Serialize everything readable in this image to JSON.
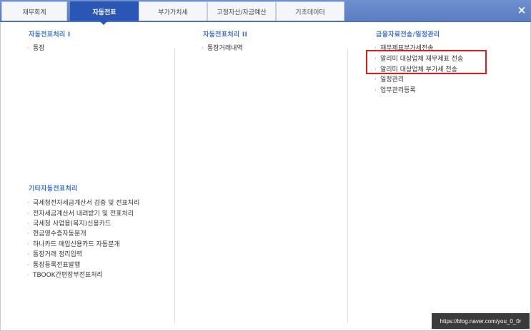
{
  "tabs": [
    {
      "label": "재무회계"
    },
    {
      "label": "자동전표"
    },
    {
      "label": "부가가치세"
    },
    {
      "label": "고정자산/자금예산"
    },
    {
      "label": "기초데이터"
    }
  ],
  "close_label": "×",
  "sections": {
    "auto1": {
      "heading": "자동전표처리 I",
      "items": [
        "통장"
      ]
    },
    "auto2": {
      "heading": "자동전표처리 II",
      "items": [
        "통장거래내역"
      ]
    },
    "finance": {
      "heading": "금융자료전송/일정관리",
      "items": [
        "재무제표부가세전송",
        "알리미 대상업체 재무제표 전송",
        "알리미 대상업체 부가세 전송",
        "일정관리",
        "업무관리등록"
      ]
    },
    "other": {
      "heading": "기타자동전표처리",
      "items": [
        "국세청전자세금계산서 검증 및 전표처리",
        "전자세금계산서 내려받기 및 전표처리",
        "국세청 사업용(복지)신용카드",
        "현금영수증자동분개",
        "하나카드 매입신용카드 자동분개",
        "통장거래 정리입력",
        "통장등록전표발행",
        "TBOOK간편장부전표처리"
      ]
    }
  },
  "bullet_char": "·",
  "watermark": "https://blog.naver.com/you_0_0r",
  "colors": {
    "accent": "#2a56b5",
    "heading": "#3a6fd0",
    "highlight": "#e5191c"
  }
}
